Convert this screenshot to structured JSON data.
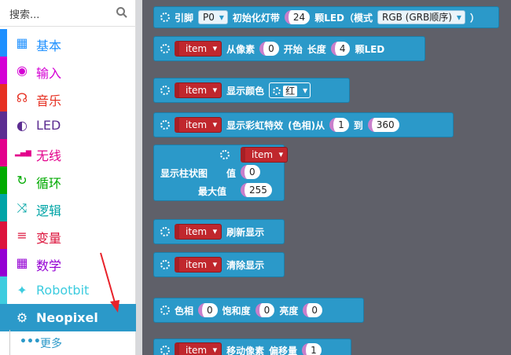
{
  "sidebar": {
    "search_placeholder": "搜索...",
    "categories": [
      {
        "label": "基本",
        "icon": "grid-icon",
        "glyph": "▦",
        "color": "#1e90ff"
      },
      {
        "label": "输入",
        "icon": "target-icon",
        "glyph": "◉",
        "color": "#d400d4"
      },
      {
        "label": "音乐",
        "icon": "headphones-icon",
        "glyph": "☊",
        "color": "#e63022"
      },
      {
        "label": "LED",
        "icon": "toggle-icon",
        "glyph": "◐",
        "color": "#5c2d91"
      },
      {
        "label": "无线",
        "icon": "signal-bars-icon",
        "glyph": "▂▄▆",
        "color": "#e3008c"
      },
      {
        "label": "循环",
        "icon": "refresh-icon",
        "glyph": "↻",
        "color": "#00aa00"
      },
      {
        "label": "逻辑",
        "icon": "shuffle-icon",
        "glyph": "⤨",
        "color": "#00a4a6"
      },
      {
        "label": "变量",
        "icon": "list-lines-icon",
        "glyph": "≡",
        "color": "#dc143c"
      },
      {
        "label": "数学",
        "icon": "calculator-icon",
        "glyph": "▦",
        "color": "#9400d3"
      },
      {
        "label": "Robotbit",
        "icon": "rebel-icon",
        "glyph": "✦",
        "color": "#3dccdf"
      },
      {
        "label": "Neopixel",
        "icon": "neopixel-gear-icon",
        "glyph": "⚙",
        "color": "#2b99c9"
      }
    ],
    "more_label": "更多",
    "more_glyph": "•••"
  },
  "blocks": {
    "b1": {
      "t1": "引脚",
      "pin": "P0",
      "t2": "初始化灯带",
      "count": "24",
      "t3": "颗LED（模式",
      "mode": "RGB (GRB顺序)",
      "t4": "）"
    },
    "b2": {
      "var": "item",
      "t1": "从像素",
      "start": "0",
      "t2": "开始",
      "t3": "长度",
      "len": "4",
      "t4": "颗LED"
    },
    "b3": {
      "var": "item",
      "t1": "显示颜色",
      "color": "红"
    },
    "b4": {
      "var": "item",
      "t1": "显示彩虹特效",
      "t2": "(色相)从",
      "from": "1",
      "t3": "到",
      "to": "360"
    },
    "b5": {
      "var": "item",
      "t1": "显示柱状图",
      "t2": "值",
      "val": "0",
      "t3": "最大值",
      "max": "255"
    },
    "b6": {
      "var": "item",
      "t1": "刷新显示"
    },
    "b7": {
      "var": "item",
      "t1": "清除显示"
    },
    "b8": {
      "t1": "色相",
      "h": "0",
      "t2": "饱和度",
      "s": "0",
      "t3": "亮度",
      "l": "0"
    },
    "b9": {
      "var": "item",
      "t1": "移动像素",
      "t2": "偏移量",
      "off": "1"
    }
  }
}
